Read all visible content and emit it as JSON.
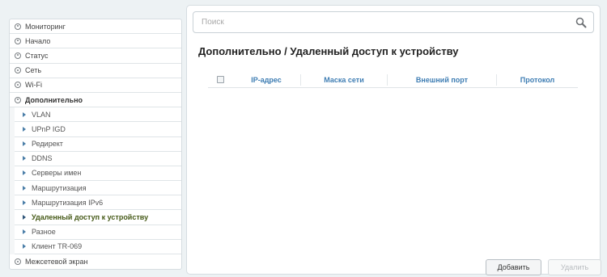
{
  "sidebar": {
    "items_before": [
      {
        "label": "Мониторинг"
      },
      {
        "label": "Начало"
      },
      {
        "label": "Статус"
      },
      {
        "label": "Сеть"
      },
      {
        "label": "Wi-Fi"
      }
    ],
    "open_item": {
      "label": "Дополнительно"
    },
    "submenu": [
      {
        "label": "VLAN"
      },
      {
        "label": "UPnP IGD"
      },
      {
        "label": "Редирект"
      },
      {
        "label": "DDNS"
      },
      {
        "label": "Серверы имен"
      },
      {
        "label": "Маршрутизация"
      },
      {
        "label": "Маршрутизация IPv6"
      },
      {
        "label": "Удаленный доступ к устройству"
      },
      {
        "label": "Разное"
      },
      {
        "label": "Клиент TR-069"
      }
    ],
    "items_after": [
      {
        "label": "Межсетевой экран"
      }
    ]
  },
  "search": {
    "placeholder": "Поиск",
    "value": ""
  },
  "page": {
    "title": "Дополнительно /  Удаленный доступ к устройству"
  },
  "table": {
    "columns": [
      "IP-адрес",
      "Маска сети",
      "Внешний порт",
      "Протокол"
    ],
    "rows": []
  },
  "buttons": {
    "add": "Добавить",
    "delete": "Удалить"
  }
}
